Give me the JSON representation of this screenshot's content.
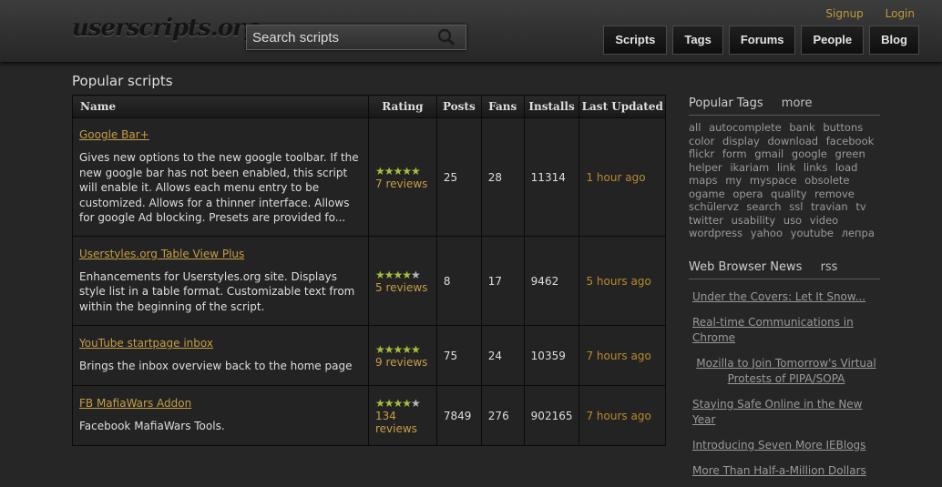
{
  "header": {
    "logo": "userscripts.org",
    "search_placeholder": "Search scripts",
    "signup": "Signup",
    "login": "Login",
    "nav": [
      "Scripts",
      "Tags",
      "Forums",
      "People",
      "Blog"
    ]
  },
  "page_title": "Popular scripts",
  "table": {
    "columns": [
      "Name",
      "Rating",
      "Posts",
      "Fans",
      "Installs",
      "Last Updated"
    ],
    "rows": [
      {
        "title": "Google Bar+",
        "desc": "Gives new options to the new google toolbar. If the new google bar has not been enabled, this script will enable it. Allows each menu entry to be customized. Allows for a thinner interface. Allows for google Ad blocking. Presets are provided fo...",
        "rating": 5,
        "reviews": "7 reviews",
        "posts": "25",
        "fans": "28",
        "installs": "11314",
        "updated": "1 hour ago"
      },
      {
        "title": "Userstyles.org Table View Plus",
        "desc": "Enhancements for Userstyles.org site. Displays style list in a table format. Customizable text from within the beginning of the script.",
        "rating": 4,
        "reviews": "5 reviews",
        "posts": "8",
        "fans": "17",
        "installs": "9462",
        "updated": "5 hours ago"
      },
      {
        "title": "YouTube startpage inbox",
        "desc": "Brings the inbox overview back to the home page",
        "rating": 5,
        "reviews": "9 reviews",
        "posts": "75",
        "fans": "24",
        "installs": "10359",
        "updated": "7 hours ago"
      },
      {
        "title": "FB MafiaWars Addon",
        "desc": "Facebook MafiaWars Tools.",
        "rating": 4,
        "reviews": "134 reviews",
        "posts": "7849",
        "fans": "276",
        "installs": "902165",
        "updated": "7 hours ago"
      }
    ]
  },
  "sidebar": {
    "tags_heading": "Popular Tags",
    "tags_more": "more",
    "tags": [
      "all",
      "autocomplete",
      "bank",
      "buttons",
      "color",
      "display",
      "download",
      "facebook",
      "flickr",
      "form",
      "gmail",
      "google",
      "green",
      "helper",
      "ikariam",
      "link",
      "links",
      "load",
      "maps",
      "my",
      "myspace",
      "obsolete",
      "ogame",
      "opera",
      "quality",
      "remove",
      "schülervz",
      "search",
      "ssl",
      "travian",
      "tv",
      "twitter",
      "usability",
      "uso",
      "video",
      "wordpress",
      "yahoo",
      "youtube",
      "лепра"
    ],
    "news_heading": "Web Browser News",
    "news_rss": "rss",
    "news": [
      "Under the Covers: Let It Snow...",
      "Real-time Communications in Chrome",
      "Mozilla to Join Tomorrow's Virtual Protests of PIPA/SOPA",
      "Staying Safe Online in the New Year",
      "Introducing Seven More IEBlogs",
      "More Than Half-a-Million Dollars"
    ]
  }
}
